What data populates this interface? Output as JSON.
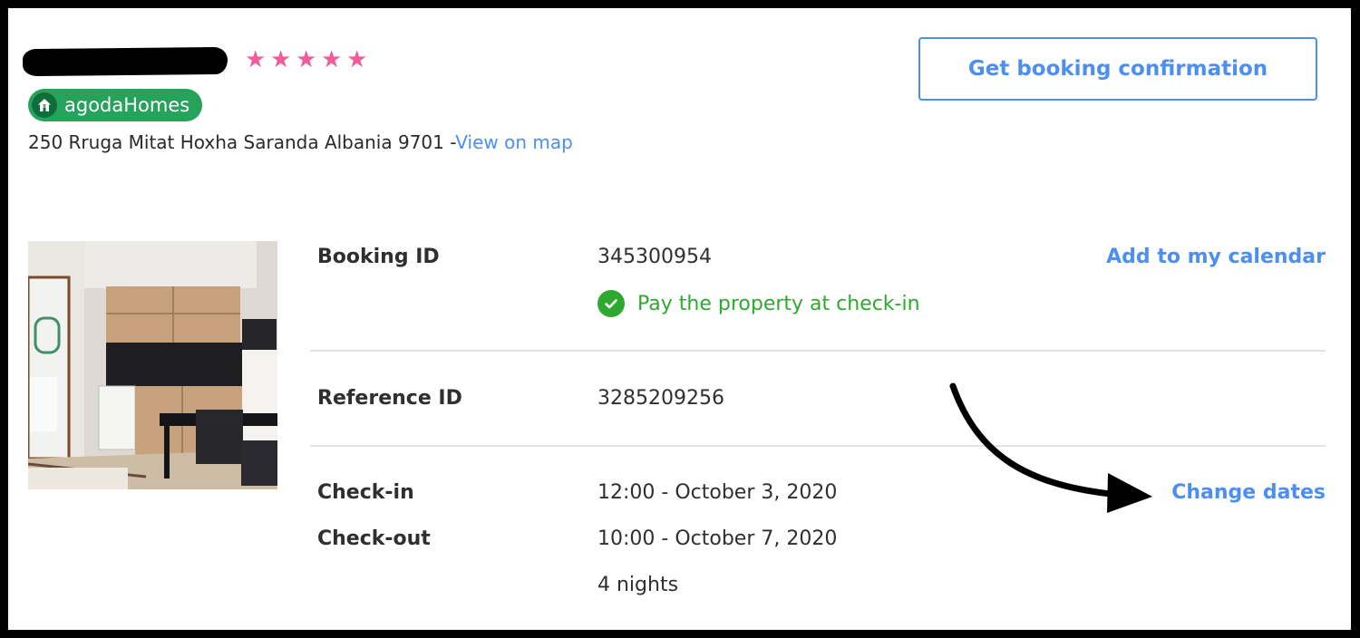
{
  "property": {
    "stars": 5,
    "badge_label": "agodaHomes",
    "address": "250 Rruga Mitat Hoxha Saranda Albania 9701 -",
    "map_link": "View on map"
  },
  "header": {
    "confirmation_button": "Get booking confirmation"
  },
  "booking": {
    "booking_id_label": "Booking ID",
    "booking_id": "345300954",
    "calendar_link": "Add to my calendar",
    "payment_note": "Pay the property at check-in",
    "reference_id_label": "Reference ID",
    "reference_id": "3285209256",
    "checkin_label": "Check-in",
    "checkin_value": "12:00 - October 3, 2020",
    "checkout_label": "Check-out",
    "checkout_value": "10:00 - October 7, 2020",
    "nights": "4 nights",
    "change_dates_link": "Change dates"
  },
  "colors": {
    "link": "#4D8FF0",
    "star": "#F25C98",
    "badge": "#26A35A",
    "success": "#2FA82F"
  },
  "icons": {
    "star": "star-icon",
    "badge": "home-icon",
    "payment": "check-circle-icon",
    "annotation": "curved-arrow-icon"
  }
}
